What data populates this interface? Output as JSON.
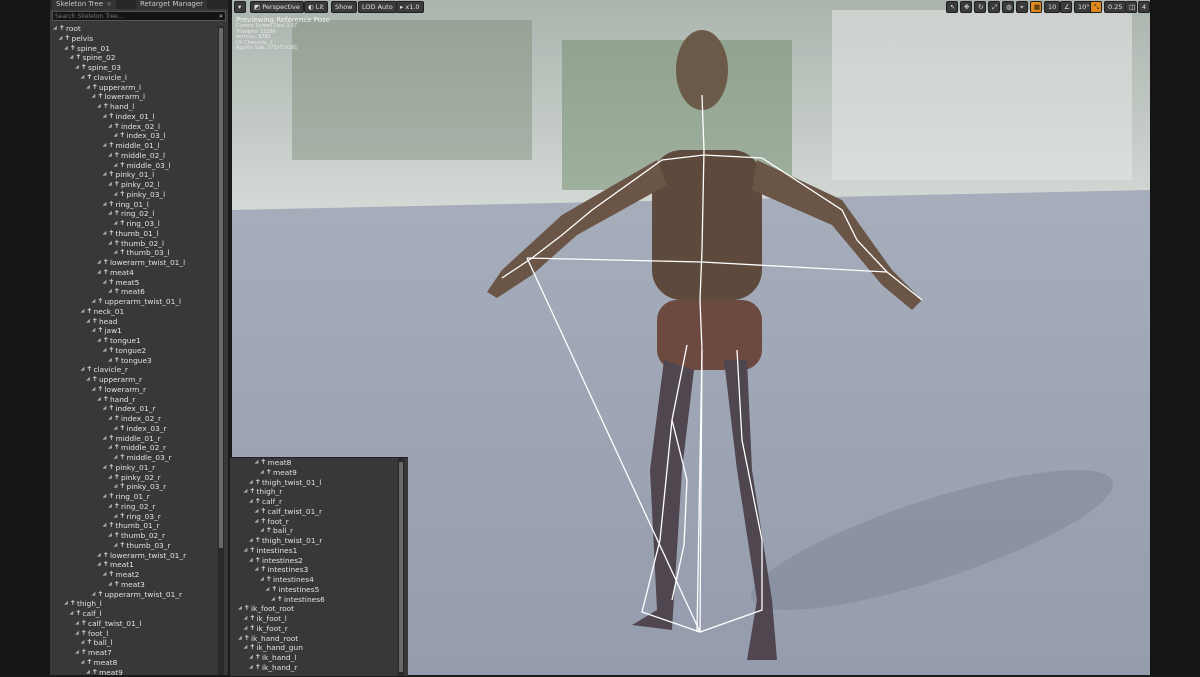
{
  "tabs": [
    {
      "label": "Skeleton Tree",
      "close": "×"
    },
    {
      "label": "Retarget Manager",
      "close": ""
    }
  ],
  "search": {
    "placeholder": "Search Skeleton Tree..."
  },
  "tree": [
    {
      "label": "root",
      "depth": 0
    },
    {
      "label": "pelvis",
      "depth": 1
    },
    {
      "label": "spine_01",
      "depth": 2
    },
    {
      "label": "spine_02",
      "depth": 3
    },
    {
      "label": "spine_03",
      "depth": 4
    },
    {
      "label": "clavicle_l",
      "depth": 5
    },
    {
      "label": "upperarm_l",
      "depth": 6
    },
    {
      "label": "lowerarm_l",
      "depth": 7
    },
    {
      "label": "hand_l",
      "depth": 8
    },
    {
      "label": "index_01_l",
      "depth": 9
    },
    {
      "label": "index_02_l",
      "depth": 10
    },
    {
      "label": "index_03_l",
      "depth": 11
    },
    {
      "label": "middle_01_l",
      "depth": 9
    },
    {
      "label": "middle_02_l",
      "depth": 10
    },
    {
      "label": "middle_03_l",
      "depth": 11
    },
    {
      "label": "pinky_01_l",
      "depth": 9
    },
    {
      "label": "pinky_02_l",
      "depth": 10
    },
    {
      "label": "pinky_03_l",
      "depth": 11
    },
    {
      "label": "ring_01_l",
      "depth": 9
    },
    {
      "label": "ring_02_l",
      "depth": 10
    },
    {
      "label": "ring_03_l",
      "depth": 11
    },
    {
      "label": "thumb_01_l",
      "depth": 9
    },
    {
      "label": "thumb_02_l",
      "depth": 10
    },
    {
      "label": "thumb_03_l",
      "depth": 11
    },
    {
      "label": "lowerarm_twist_01_l",
      "depth": 8
    },
    {
      "label": "meat4",
      "depth": 8
    },
    {
      "label": "meat5",
      "depth": 9
    },
    {
      "label": "meat6",
      "depth": 10
    },
    {
      "label": "upperarm_twist_01_l",
      "depth": 7
    },
    {
      "label": "neck_01",
      "depth": 5
    },
    {
      "label": "head",
      "depth": 6
    },
    {
      "label": "jaw1",
      "depth": 7
    },
    {
      "label": "tongue1",
      "depth": 8
    },
    {
      "label": "tongue2",
      "depth": 9
    },
    {
      "label": "tongue3",
      "depth": 10
    },
    {
      "label": "clavicle_r",
      "depth": 5
    },
    {
      "label": "upperarm_r",
      "depth": 6
    },
    {
      "label": "lowerarm_r",
      "depth": 7
    },
    {
      "label": "hand_r",
      "depth": 8
    },
    {
      "label": "index_01_r",
      "depth": 9
    },
    {
      "label": "index_02_r",
      "depth": 10
    },
    {
      "label": "index_03_r",
      "depth": 11
    },
    {
      "label": "middle_01_r",
      "depth": 9
    },
    {
      "label": "middle_02_r",
      "depth": 10
    },
    {
      "label": "middle_03_r",
      "depth": 11
    },
    {
      "label": "pinky_01_r",
      "depth": 9
    },
    {
      "label": "pinky_02_r",
      "depth": 10
    },
    {
      "label": "pinky_03_r",
      "depth": 11
    },
    {
      "label": "ring_01_r",
      "depth": 9
    },
    {
      "label": "ring_02_r",
      "depth": 10
    },
    {
      "label": "ring_03_r",
      "depth": 11
    },
    {
      "label": "thumb_01_r",
      "depth": 9
    },
    {
      "label": "thumb_02_r",
      "depth": 10
    },
    {
      "label": "thumb_03_r",
      "depth": 11
    },
    {
      "label": "lowerarm_twist_01_r",
      "depth": 8
    },
    {
      "label": "meat1",
      "depth": 8
    },
    {
      "label": "meat2",
      "depth": 9
    },
    {
      "label": "meat3",
      "depth": 10
    },
    {
      "label": "upperarm_twist_01_r",
      "depth": 7
    },
    {
      "label": "thigh_l",
      "depth": 2
    },
    {
      "label": "calf_l",
      "depth": 3
    },
    {
      "label": "calf_twist_01_l",
      "depth": 4
    },
    {
      "label": "foot_l",
      "depth": 4
    },
    {
      "label": "ball_l",
      "depth": 5
    },
    {
      "label": "meat7",
      "depth": 4
    },
    {
      "label": "meat8",
      "depth": 5
    },
    {
      "label": "meat9",
      "depth": 6
    }
  ],
  "tree2": [
    {
      "label": "meat8",
      "depth": 3
    },
    {
      "label": "meat9",
      "depth": 4
    },
    {
      "label": "thigh_twist_01_l",
      "depth": 2
    },
    {
      "label": "thigh_r",
      "depth": 1
    },
    {
      "label": "calf_r",
      "depth": 2
    },
    {
      "label": "calf_twist_01_r",
      "depth": 3
    },
    {
      "label": "foot_r",
      "depth": 3
    },
    {
      "label": "ball_r",
      "depth": 4
    },
    {
      "label": "thigh_twist_01_r",
      "depth": 2
    },
    {
      "label": "intestines1",
      "depth": 1
    },
    {
      "label": "intestines2",
      "depth": 2
    },
    {
      "label": "intestines3",
      "depth": 3
    },
    {
      "label": "intestines4",
      "depth": 4
    },
    {
      "label": "intestines5",
      "depth": 5
    },
    {
      "label": "intestines6",
      "depth": 6
    },
    {
      "label": "ik_foot_root",
      "depth": 0
    },
    {
      "label": "ik_foot_l",
      "depth": 1
    },
    {
      "label": "ik_foot_r",
      "depth": 1
    },
    {
      "label": "ik_hand_root",
      "depth": 0
    },
    {
      "label": "ik_hand_gun",
      "depth": 1
    },
    {
      "label": "ik_hand_l",
      "depth": 2
    },
    {
      "label": "ik_hand_r",
      "depth": 2
    }
  ],
  "toolbar": {
    "perspective": "Perspective",
    "lit": "Lit",
    "show": "Show",
    "lod": "LOD Auto",
    "speed": "x1.0",
    "grid_snap": "10",
    "angle_snap": "10°",
    "scale_snap": "0.25",
    "camera_speed": "4"
  },
  "hud": {
    "title": "Previewing Reference Pose",
    "stats": [
      "Current Screen Size: 1.67",
      "Triangles: 15299",
      "Vertices: 9780",
      "UV Channels: 1",
      "Approx Size: 273x71x281"
    ]
  },
  "colors": {
    "accent": "#e08a1e",
    "panel": "#383838",
    "floor": "#9aa2b2"
  }
}
